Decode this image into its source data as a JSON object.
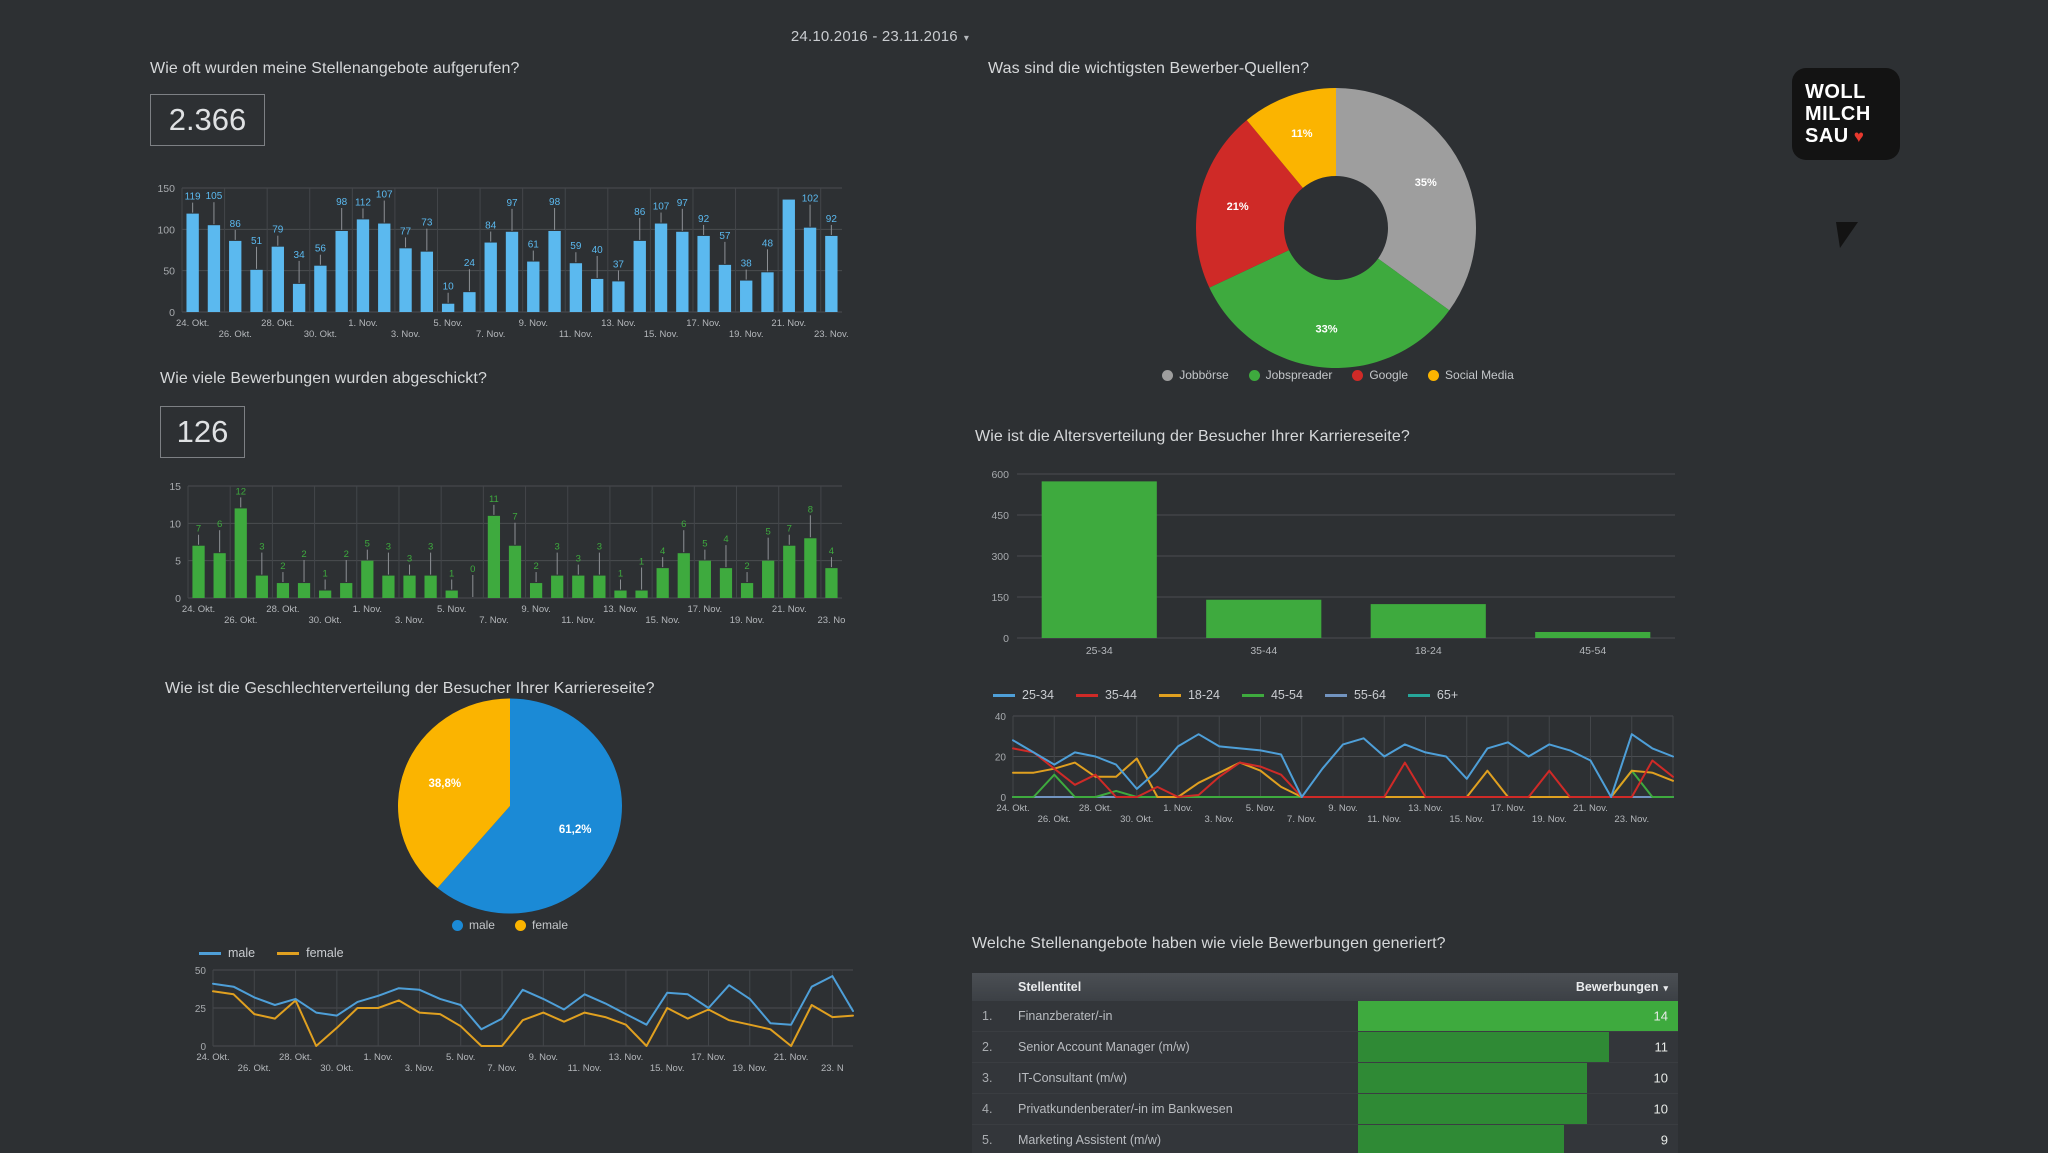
{
  "header": {
    "date_range": "24.10.2016 - 23.11.2016",
    "caret": "▾"
  },
  "logo": {
    "line1": "WOLL",
    "line2": "MILCH",
    "line3": "SAU",
    "heart": "♥"
  },
  "colors": {
    "background": "#2d3033",
    "blue": "#5bb9ef",
    "green": "#3eaa3e",
    "grey": "#9e9e9e",
    "red": "#cf2a27",
    "yellow": "#fbb400",
    "pie_blue": "#1b8ad6",
    "text": "#d6d8da"
  },
  "panels": {
    "views": {
      "title": "Wie oft wurden meine Stellenangebote aufgerufen?",
      "kpi": "2.366"
    },
    "applications": {
      "title": "Wie viele Bewerbungen wurden abgeschickt?",
      "kpi": "126"
    },
    "gender": {
      "title": "Wie ist die Geschlechterverteilung der Besucher Ihrer Karriereseite?"
    },
    "sources": {
      "title": "Was sind die wichtigsten Bewerber-Quellen?"
    },
    "age": {
      "title": "Wie ist die Altersverteilung der Besucher Ihrer Karriereseite?"
    },
    "jobs": {
      "title": "Welche Stellenangebote haben wie viele Bewerbungen generiert?"
    }
  },
  "jobs_table": {
    "columns": {
      "rank": "",
      "title": "Stellentitel",
      "applications": "Bewerbungen",
      "sort_caret": "▾"
    },
    "rows": [
      {
        "rank": "1.",
        "title": "Finanzberater/-in",
        "applications": 14
      },
      {
        "rank": "2.",
        "title": "Senior Account Manager (m/w)",
        "applications": 11
      },
      {
        "rank": "3.",
        "title": "IT-Consultant (m/w)",
        "applications": 10
      },
      {
        "rank": "4.",
        "title": "Privatkundenberater/-in im Bankwesen",
        "applications": 10
      },
      {
        "rank": "5.",
        "title": "Marketing Assistent (m/w)",
        "applications": 9
      }
    ]
  },
  "chart_data": [
    {
      "id": "views_bar",
      "type": "bar",
      "title": "Wie oft wurden meine Stellenangebote aufgerufen?",
      "xlabel": "",
      "ylabel": "",
      "ylim": [
        0,
        150
      ],
      "yticks": [
        0,
        50,
        100,
        150
      ],
      "grid": true,
      "color": "#5bb9ef",
      "categories": [
        "24. Okt.",
        "25. Okt.",
        "26. Okt.",
        "27. Okt.",
        "28. Okt.",
        "29. Okt.",
        "30. Okt.",
        "31. Okt.",
        "1. Nov.",
        "2. Nov.",
        "3. Nov.",
        "4. Nov.",
        "5. Nov.",
        "6. Nov.",
        "7. Nov.",
        "8. Nov.",
        "9. Nov.",
        "10. Nov.",
        "11. Nov.",
        "12. Nov.",
        "13. Nov.",
        "14. Nov.",
        "15. Nov.",
        "16. Nov.",
        "17. Nov.",
        "18. Nov.",
        "19. Nov.",
        "20. Nov.",
        "21. Nov.",
        "22. Nov.",
        "23. Nov."
      ],
      "tick_labels": [
        "24. Okt.",
        "26. Okt.",
        "28. Okt.",
        "30. Okt.",
        "1. Nov.",
        "3. Nov.",
        "5. Nov.",
        "7. Nov.",
        "9. Nov.",
        "11. Nov.",
        "13. Nov.",
        "15. Nov.",
        "17. Nov.",
        "19. Nov.",
        "21. Nov.",
        "23. Nov."
      ],
      "values": [
        119,
        105,
        86,
        51,
        79,
        34,
        56,
        98,
        112,
        107,
        77,
        73,
        10,
        24,
        84,
        97,
        61,
        98,
        59,
        40,
        37,
        86,
        107,
        97,
        92,
        57,
        38,
        48,
        136,
        102,
        92
      ],
      "labels": [
        "119",
        "105",
        "86",
        "51",
        "79",
        "34",
        "56",
        "98",
        "112",
        "107",
        "77",
        "73",
        "10",
        "24",
        "84",
        "97",
        "61",
        "98",
        "59",
        "40",
        "37",
        "86",
        "107",
        "97",
        "92",
        "57",
        "38",
        "48",
        "",
        "102",
        "92"
      ]
    },
    {
      "id": "applications_bar",
      "type": "bar",
      "title": "Wie viele Bewerbungen wurden abgeschickt?",
      "ylim": [
        0,
        15
      ],
      "yticks": [
        0,
        5,
        10,
        15
      ],
      "grid": true,
      "color": "#3eaa3e",
      "tick_labels": [
        "24. Okt.",
        "26. Okt.",
        "28. Okt.",
        "30. Okt.",
        "1. Nov.",
        "3. Nov.",
        "5. Nov.",
        "7. Nov.",
        "9. Nov.",
        "11. Nov.",
        "13. Nov.",
        "15. Nov.",
        "17. Nov.",
        "19. Nov.",
        "21. Nov.",
        "23. No"
      ],
      "values": [
        7,
        6,
        12,
        3,
        2,
        2,
        1,
        2,
        5,
        3,
        3,
        3,
        1,
        0,
        11,
        7,
        2,
        3,
        3,
        3,
        1,
        1,
        4,
        6,
        5,
        4,
        2,
        5,
        7,
        8,
        4
      ],
      "labels": [
        "7",
        "6",
        "12",
        "3",
        "2",
        "2",
        "1",
        "2",
        "5",
        "3",
        "3",
        "3",
        "1",
        "0",
        "11",
        "7",
        "2",
        "3",
        "3",
        "3",
        "1",
        "1",
        "4",
        "6",
        "5",
        "4",
        "2",
        "5",
        "7",
        "8",
        "4"
      ]
    },
    {
      "id": "sources_donut",
      "type": "pie",
      "title": "Was sind die wichtigsten Bewerber-Quellen?",
      "donut": true,
      "legend_position": "bottom",
      "labels": [
        "Jobbörse",
        "Jobspreader",
        "Google",
        "Social Media"
      ],
      "values": [
        35,
        33,
        21,
        11
      ],
      "value_labels": [
        "35%",
        "33%",
        "21%",
        "11%"
      ],
      "colors": [
        "#9e9e9e",
        "#3eaa3e",
        "#cf2a27",
        "#fbb400"
      ]
    },
    {
      "id": "gender_pie",
      "type": "pie",
      "title": "Wie ist die Geschlechterverteilung der Besucher Ihrer Karriereseite?",
      "donut": false,
      "legend_position": "bottom",
      "labels": [
        "male",
        "female"
      ],
      "values": [
        61.2,
        38.8
      ],
      "value_labels": [
        "61,2%",
        "38,8%"
      ],
      "colors": [
        "#1b8ad6",
        "#fbb400"
      ]
    },
    {
      "id": "gender_line",
      "type": "line",
      "ylim": [
        0,
        50
      ],
      "yticks": [
        0,
        25,
        50
      ],
      "grid": true,
      "legend_position": "top",
      "tick_labels": [
        "24. Okt.",
        "26. Okt.",
        "28. Okt.",
        "30. Okt.",
        "1. Nov.",
        "3. Nov.",
        "5. Nov.",
        "7. Nov.",
        "9. Nov.",
        "11. Nov.",
        "13. Nov.",
        "15. Nov.",
        "17. Nov.",
        "19. Nov.",
        "21. Nov.",
        "23. N"
      ],
      "series": [
        {
          "name": "male",
          "color": "#4e9fd8",
          "values": [
            41,
            39,
            32,
            27,
            31,
            22,
            20,
            29,
            33,
            38,
            37,
            31,
            27,
            11,
            18,
            37,
            31,
            24,
            34,
            28,
            21,
            14,
            35,
            34,
            25,
            40,
            31,
            15,
            14,
            39,
            46,
            23
          ]
        },
        {
          "name": "female",
          "color": "#e0a020",
          "values": [
            36,
            34,
            21,
            18,
            30,
            0,
            12,
            25,
            25,
            30,
            22,
            21,
            13,
            0,
            0,
            17,
            22,
            16,
            22,
            19,
            14,
            0,
            25,
            18,
            24,
            17,
            14,
            11,
            0,
            27,
            19,
            20
          ]
        }
      ]
    },
    {
      "id": "age_bar",
      "type": "bar",
      "title": "Wie ist die Altersverteilung der Besucher Ihrer Karriereseite?",
      "ylim": [
        0,
        600
      ],
      "yticks": [
        0,
        150,
        300,
        450,
        600
      ],
      "grid": true,
      "color": "#3eaa3e",
      "categories": [
        "25-34",
        "35-44",
        "18-24",
        "45-54"
      ],
      "values": [
        573,
        140,
        124,
        22
      ]
    },
    {
      "id": "age_line",
      "type": "line",
      "ylim": [
        0,
        40
      ],
      "yticks": [
        0,
        20,
        40
      ],
      "grid": true,
      "legend_position": "top",
      "tick_labels": [
        "24. Okt.",
        "26. Okt.",
        "28. Okt.",
        "30. Okt.",
        "1. Nov.",
        "3. Nov.",
        "5. Nov.",
        "7. Nov.",
        "9. Nov.",
        "11. Nov.",
        "13. Nov.",
        "15. Nov.",
        "17. Nov.",
        "19. Nov.",
        "21. Nov.",
        "23. Nov."
      ],
      "series": [
        {
          "name": "25-34",
          "color": "#4e9fd8",
          "values": [
            28,
            22,
            16,
            22,
            20,
            16,
            4,
            13,
            25,
            31,
            25,
            24,
            23,
            21,
            0,
            14,
            26,
            29,
            20,
            26,
            22,
            20,
            9,
            24,
            27,
            20,
            26,
            23,
            18,
            0,
            31,
            24,
            20
          ]
        },
        {
          "name": "35-44",
          "color": "#cf2a27",
          "values": [
            24,
            22,
            14,
            6,
            11,
            0,
            0,
            5,
            0,
            1,
            10,
            17,
            15,
            11,
            0,
            0,
            0,
            0,
            0,
            17,
            0,
            0,
            0,
            0,
            0,
            0,
            13,
            0,
            0,
            0,
            0,
            18,
            10
          ]
        },
        {
          "name": "18-24",
          "color": "#e0a020",
          "values": [
            12,
            12,
            14,
            17,
            10,
            10,
            19,
            0,
            0,
            7,
            12,
            17,
            13,
            5,
            0,
            0,
            0,
            0,
            0,
            0,
            0,
            0,
            0,
            13,
            0,
            0,
            0,
            0,
            0,
            0,
            13,
            12,
            8
          ]
        },
        {
          "name": "45-54",
          "color": "#3eaa3e",
          "values": [
            0,
            0,
            11,
            0,
            0,
            3,
            0,
            0,
            0,
            0,
            0,
            0,
            0,
            0,
            0,
            0,
            0,
            0,
            0,
            0,
            0,
            0,
            0,
            0,
            0,
            0,
            0,
            0,
            0,
            0,
            13,
            0,
            0
          ]
        },
        {
          "name": "55-64",
          "color": "#7294c0",
          "values": [
            0,
            0,
            0,
            0,
            0,
            0,
            0,
            0,
            0,
            0,
            0,
            0,
            0,
            0,
            0,
            0,
            0,
            0,
            0,
            0,
            0,
            0,
            0,
            0,
            0,
            0,
            0,
            0,
            0,
            0,
            0,
            0,
            0
          ]
        },
        {
          "name": "65+",
          "color": "#26a69a",
          "values": [
            0,
            0,
            0,
            0,
            0,
            0,
            0,
            0,
            0,
            0,
            0,
            0,
            0,
            0,
            0,
            0,
            0,
            0,
            0,
            0,
            0,
            0,
            0,
            0,
            0,
            0,
            0,
            0,
            0,
            0,
            0,
            0,
            0
          ]
        }
      ]
    }
  ]
}
